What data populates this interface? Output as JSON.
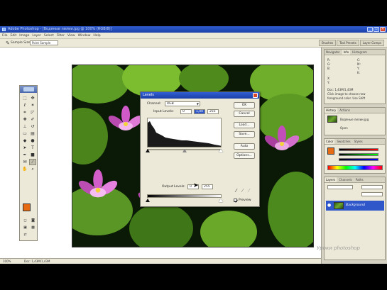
{
  "window": {
    "title": "Adobe Photoshop - [Водяные лилии.jpg @ 100% (RGB/8)]"
  },
  "menubar": {
    "items": [
      "File",
      "Edit",
      "Image",
      "Layer",
      "Select",
      "Filter",
      "View",
      "Window",
      "Help"
    ]
  },
  "options": {
    "sample_label": "Sample Size:",
    "sample_value": "Point Sample"
  },
  "palette_well": {
    "tabs": [
      "Brushes",
      "Tool Presets",
      "Layer Comps"
    ]
  },
  "levels_dialog": {
    "title": "Levels",
    "channel_label": "Channel:",
    "channel_value": "RGB",
    "input_label": "Input Levels:",
    "input_values": [
      "0",
      "1,00",
      "255"
    ],
    "output_label": "Output Levels:",
    "output_values": [
      "0",
      "255"
    ],
    "buttons": [
      "OK",
      "Cancel",
      "Load...",
      "Save...",
      "Auto",
      "Options..."
    ],
    "preview_label": "Preview",
    "preview_checked": true
  },
  "panels": {
    "navigator_tabs": [
      "Navigator",
      "Info",
      "Histogram"
    ],
    "info_lines": [
      "R:",
      "G:",
      "B:",
      "C:",
      "M:",
      "Y:",
      "K:",
      "X:",
      "Y:"
    ],
    "doc_info": [
      "Doc: 1,43M/1,43M",
      "Click image to choose new",
      "foreground color. Use Shift"
    ],
    "history_tabs": [
      "History",
      "Actions"
    ],
    "history_file": "Водяные лилии.jpg",
    "history_item": "Open",
    "color_tabs": [
      "Color",
      "Swatches",
      "Styles"
    ],
    "layers_tabs": [
      "Layers",
      "Channels",
      "Paths"
    ],
    "layer_name": "Background"
  },
  "statusbar": {
    "zoom": "100%",
    "doc": "Doc: 1,43M/1,43M"
  },
  "watermark": "Уроки photoshop"
}
